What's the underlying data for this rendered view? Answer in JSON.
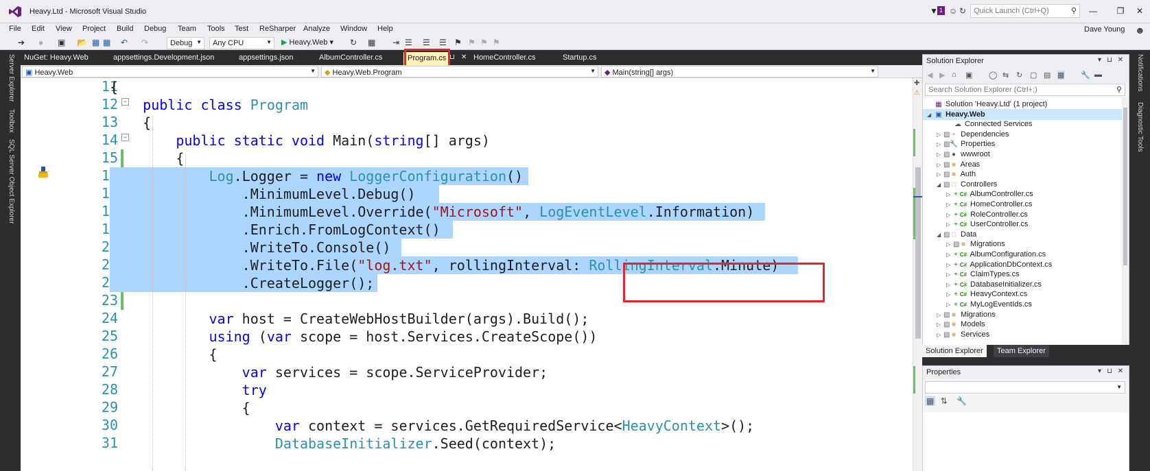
{
  "window": {
    "title": "Heavy.Ltd - Microsoft Visual Studio",
    "notification_count": "1",
    "quick_launch_placeholder": "Quick Launch (Ctrl+Q)",
    "user_name": "Dave Young"
  },
  "menu": [
    "File",
    "Edit",
    "View",
    "Project",
    "Build",
    "Debug",
    "Team",
    "Tools",
    "Test",
    "ReSharper",
    "Analyze",
    "Window",
    "Help"
  ],
  "toolbar": {
    "configuration": "Debug",
    "platform": "Any CPU",
    "run_target": "Heavy.Web"
  },
  "left_tool_tabs": [
    "Server Explorer",
    "Toolbox",
    "SQL Server Object Explorer"
  ],
  "right_tool_tabs": [
    "Notifications",
    "Diagnostic Tools"
  ],
  "document_tabs": [
    {
      "label": "NuGet: Heavy.Web",
      "active": false
    },
    {
      "label": "appsettings.Development.json",
      "active": false
    },
    {
      "label": "appsettings.json",
      "active": false
    },
    {
      "label": "AlbumController.cs",
      "active": false
    },
    {
      "label": "Program.cs",
      "active": true
    },
    {
      "label": "HomeController.cs",
      "active": false
    },
    {
      "label": "Startup.cs",
      "active": false
    }
  ],
  "navigation": {
    "project": "Heavy.Web",
    "type": "Heavy.Web.Program",
    "member": "Main(string[] args)"
  },
  "editor": {
    "line_numbers": [
      "11",
      "12",
      "13",
      "14",
      "15",
      "16",
      "17",
      "18",
      "19",
      "20",
      "21",
      "22",
      "23",
      "24",
      "25",
      "26",
      "27",
      "28",
      "29",
      "30",
      "31"
    ],
    "lines": [
      "{",
      "    public class Program",
      "    {",
      "        public static void Main(string[] args)",
      "        {",
      "            Log.Logger = new LoggerConfiguration()",
      "                .MinimumLevel.Debug()",
      "                .MinimumLevel.Override(\"Microsoft\", LogEventLevel.Information)",
      "                .Enrich.FromLogContext()",
      "                .WriteTo.Console()",
      "                .WriteTo.File(\"log.txt\", rollingInterval: RollingInterval.Minute)",
      "                .CreateLogger();",
      "",
      "            var host = CreateWebHostBuilder(args).Build();",
      "            using (var scope = host.Services.CreateScope())",
      "            {",
      "                var services = scope.ServiceProvider;",
      "                try",
      "                {",
      "                    var context = services.GetRequiredService<HeavyContext>();",
      "                    DatabaseInitializer.Seed(context);"
    ]
  },
  "solution_explorer": {
    "title": "Solution Explorer",
    "search_placeholder": "Search Solution Explorer (Ctrl+;)",
    "items": [
      {
        "label": "Solution 'Heavy.Ltd' (1 project)",
        "level": 0,
        "icon": "solution-icon",
        "expander": ""
      },
      {
        "label": "Heavy.Web",
        "level": 0,
        "icon": "web-project-icon",
        "expander": "open",
        "selected": true,
        "bold": true
      },
      {
        "label": "Connected Services",
        "level": 2,
        "icon": "cloud-icon",
        "expander": ""
      },
      {
        "label": "Dependencies",
        "level": 1,
        "icon": "dependencies-icon",
        "expander": "closed"
      },
      {
        "label": "Properties",
        "level": 1,
        "icon": "wrench-icon",
        "expander": "closed"
      },
      {
        "label": "wwwroot",
        "level": 1,
        "icon": "globe-icon",
        "expander": "closed"
      },
      {
        "label": "Areas",
        "level": 1,
        "icon": "folder-icon",
        "expander": "closed"
      },
      {
        "label": "Auth",
        "level": 1,
        "icon": "folder-icon",
        "expander": "closed"
      },
      {
        "label": "Controllers",
        "level": 1,
        "icon": "folder-open-icon",
        "expander": "open"
      },
      {
        "label": "AlbumController.cs",
        "level": 2,
        "icon": "csharp-file-icon",
        "expander": "closed"
      },
      {
        "label": "HomeController.cs",
        "level": 2,
        "icon": "csharp-file-icon",
        "expander": "closed"
      },
      {
        "label": "RoleController.cs",
        "level": 2,
        "icon": "csharp-file-icon",
        "expander": "closed"
      },
      {
        "label": "UserController.cs",
        "level": 2,
        "icon": "csharp-file-icon",
        "expander": "closed"
      },
      {
        "label": "Data",
        "level": 1,
        "icon": "folder-open-icon",
        "expander": "open"
      },
      {
        "label": "Migrations",
        "level": 2,
        "icon": "folder-icon",
        "expander": "closed"
      },
      {
        "label": "AlbumConfiguration.cs",
        "level": 2,
        "icon": "csharp-file-icon",
        "expander": "closed"
      },
      {
        "label": "ApplicationDbContext.cs",
        "level": 2,
        "icon": "csharp-file-icon",
        "expander": "closed"
      },
      {
        "label": "ClaimTypes.cs",
        "level": 2,
        "icon": "csharp-file-icon",
        "expander": "closed"
      },
      {
        "label": "DatabaseInitializer.cs",
        "level": 2,
        "icon": "csharp-file-icon",
        "expander": "closed"
      },
      {
        "label": "HeavyContext.cs",
        "level": 2,
        "icon": "csharp-file-icon",
        "expander": "closed"
      },
      {
        "label": "MyLogEventIds.cs",
        "level": 2,
        "icon": "csharp-file-icon",
        "expander": "closed"
      },
      {
        "label": "Migrations",
        "level": 1,
        "icon": "folder-icon",
        "expander": "closed"
      },
      {
        "label": "Models",
        "level": 1,
        "icon": "folder-icon",
        "expander": "closed"
      },
      {
        "label": "Services",
        "level": 1,
        "icon": "folder-icon",
        "expander": "closed"
      }
    ],
    "tabs": [
      {
        "label": "Solution Explorer",
        "active": true
      },
      {
        "label": "Team Explorer",
        "active": false
      }
    ]
  },
  "properties_pane": {
    "title": "Properties"
  },
  "colors": {
    "selection": "#add6ff",
    "keyword": "#0000ff",
    "type": "#2b91af",
    "string": "#a31515",
    "annotation": "#e8232a",
    "active_tab": "#fff1b8"
  }
}
